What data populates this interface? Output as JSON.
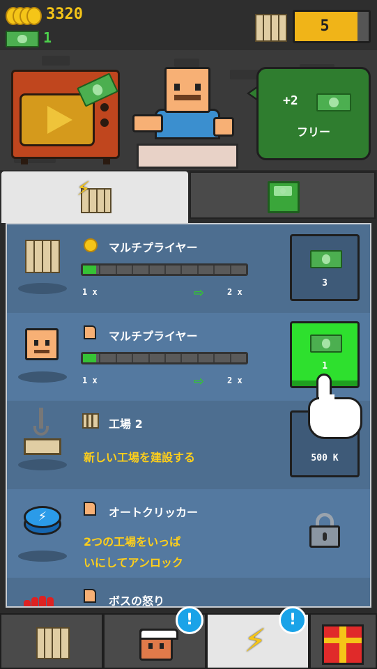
{
  "hud": {
    "coins": "3320",
    "cash": "1",
    "factory_count": "5",
    "factory_progress": 0.85
  },
  "offer": {
    "bonus": "+2",
    "free_label": "フリー"
  },
  "tabs": [
    {
      "name": "boosts",
      "icon": "lightning-factory-icon",
      "active": true
    },
    {
      "name": "cash-shop",
      "icon": "cash-stack-icon",
      "active": false
    }
  ],
  "upgrades": [
    {
      "icon": "factory-icon",
      "currency_icon": "coin-icon",
      "title": "マルチプライヤー",
      "progress": 0.08,
      "from": "1 x",
      "to": "2 x",
      "cost": "3",
      "affordable": false
    },
    {
      "icon": "boss-face-icon",
      "currency_icon": "flag-icon",
      "title": "マルチプライヤー",
      "progress": 0.08,
      "from": "1 x",
      "to": "2 x",
      "cost": "1",
      "affordable": true
    },
    {
      "icon": "crane-icon",
      "currency_icon": "factory-small-icon",
      "title": "工場 2",
      "desc": "新しい工場を建設する",
      "cost": "500 K",
      "affordable": false
    },
    {
      "icon": "auto-click-button-icon",
      "currency_icon": "flag-icon",
      "title": "オートクリッカー",
      "desc_line1": "2つの工場をいっぱ",
      "desc_line2": "いにしてアンロック",
      "locked": true
    },
    {
      "icon": "boss-rage-icon",
      "currency_icon": "flag-icon",
      "title": "ボスの怒り"
    }
  ],
  "bottom_nav": [
    {
      "name": "factories",
      "icon": "factory-icon"
    },
    {
      "name": "managers",
      "icon": "worker-face-icon",
      "badge": "!"
    },
    {
      "name": "boosts",
      "icon": "lightning-icon",
      "badge": "!",
      "active": true
    },
    {
      "name": "gifts",
      "icon": "gift-icon"
    }
  ],
  "colors": {
    "coin": "#f5c518",
    "cash_green": "#4caf50",
    "buy_enabled": "#2ee02e",
    "panel_blue": "#4d6e90",
    "accent_yellow": "#ffcf1a",
    "badge_blue": "#1aa3e8"
  }
}
